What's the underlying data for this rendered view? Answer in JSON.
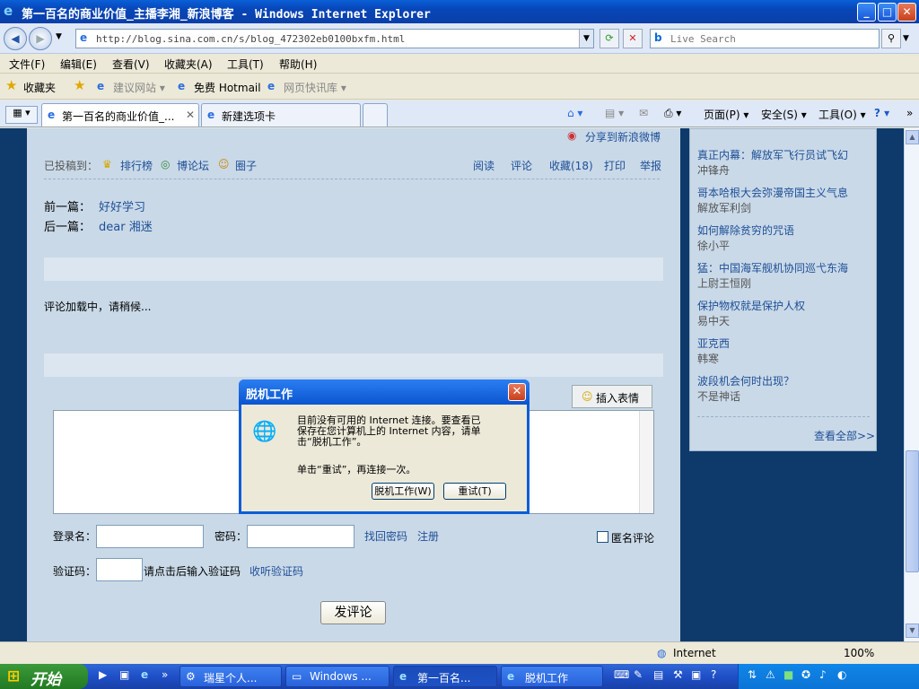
{
  "window": {
    "title": "第一百名的商业价值_主播李湘_新浪博客 - Windows Internet Explorer",
    "min": "_",
    "max": "□",
    "close": "✕"
  },
  "address": {
    "url": "http://blog.sina.com.cn/s/blog_472302eb0100bxfm.html",
    "search_placeholder": "Live Search"
  },
  "menu": [
    "文件(F)",
    "编辑(E)",
    "查看(V)",
    "收藏夹(A)",
    "工具(T)",
    "帮助(H)"
  ],
  "favorites": {
    "label": "收藏夹",
    "items": [
      "建议网站 ▾",
      "免费 Hotmail",
      "网页快讯库 ▾"
    ]
  },
  "tabs": [
    "第一百名的商业价值_...",
    "新建选项卡"
  ],
  "commands": [
    "页面(P) ▾",
    "安全(S) ▾",
    "工具(O) ▾"
  ],
  "article": {
    "share": "分享到新浪微博",
    "submitted_label": "已投稿到：",
    "submitted": [
      "排行榜",
      "博论坛",
      "圈子"
    ],
    "actions": [
      "阅读",
      "评论",
      "收藏(18)",
      "打印",
      "举报"
    ],
    "prev_label": "前一篇：",
    "prev": "好好学习",
    "next_label": "后一篇：",
    "next": "dear 湘迷",
    "loading": "评论加载中，请稍候...",
    "insert_emoji": "插入表情",
    "login_label": "登录名：",
    "password_label": "密码：",
    "forgot": "找回密码",
    "register": "注册",
    "anonymous": "匿名评论",
    "captcha_label": "验证码：",
    "captcha_hint": "请点击后输入验证码",
    "listen_captcha": "收听验证码",
    "submit": "发评论"
  },
  "sidebar": {
    "items": [
      {
        "title": "真正内幕：解放军飞行员试飞幻",
        "author": "冲锋舟"
      },
      {
        "title": "哥本哈根大会弥漫帝国主义气息",
        "author": "解放军利剑"
      },
      {
        "title": "如何解除贫穷的咒语",
        "author": "徐小平"
      },
      {
        "title": "猛：中国海军舰机协同巡弋东海",
        "author": "上尉王恒刚"
      },
      {
        "title": "保护物权就是保护人权",
        "author": "易中天"
      },
      {
        "title": "亚克西",
        "author": "韩寒"
      },
      {
        "title": "波段机会何时出现？",
        "author": "不是神话"
      }
    ],
    "view_all": "查看全部>>"
  },
  "dialog": {
    "title": "脱机工作",
    "line1": "目前没有可用的 Internet 连接。要查看已",
    "line2": "保存在您计算机上的 Internet 内容，请单",
    "line3": "击“脱机工作”。",
    "line4": "单击“重试”，再连接一次。",
    "offline_btn": "脱机工作(W)",
    "retry_btn": "重试(T)"
  },
  "status": {
    "zone": "Internet",
    "zoom": "100%"
  },
  "taskbar": {
    "start": "开始",
    "items": [
      "瑞星个人...",
      "Windows ...",
      "第一百名...",
      "脱机工作"
    ]
  }
}
